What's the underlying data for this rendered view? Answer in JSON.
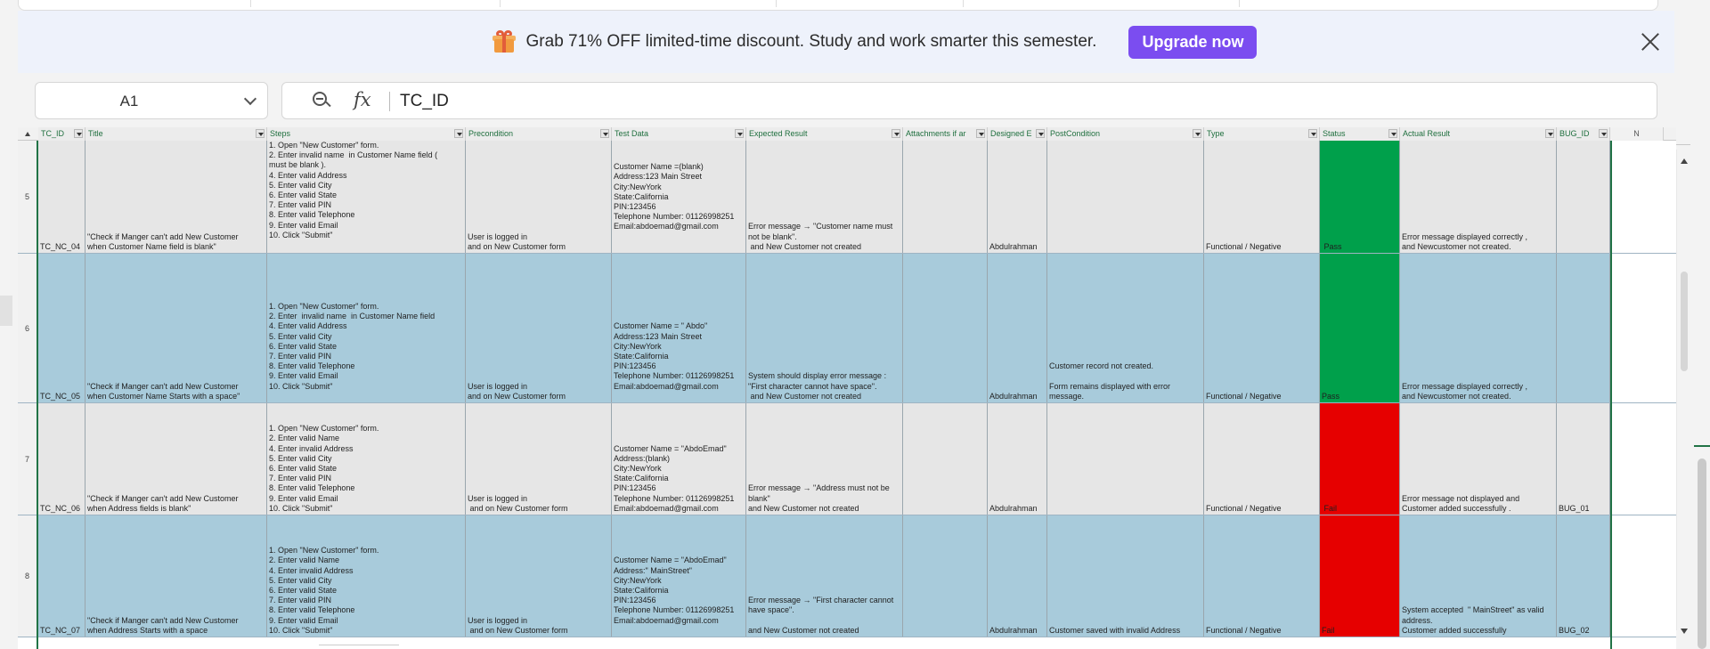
{
  "promo": {
    "text": "Grab 71% OFF limited-time discount. Study and work smarter this semester.",
    "button": "Upgrade now",
    "accent": "#7b4df0"
  },
  "formula_bar": {
    "cell_ref": "A1",
    "fx_label": "fx",
    "content": "TC_ID"
  },
  "columns": [
    {
      "label": "TC_ID",
      "filter": true
    },
    {
      "label": "Title",
      "filter": true
    },
    {
      "label": "Steps",
      "filter": true
    },
    {
      "label": "Precondition",
      "filter": true
    },
    {
      "label": "Test Data",
      "filter": true
    },
    {
      "label": "Expected Result",
      "filter": true
    },
    {
      "label": "Attachments if ar",
      "filter": true
    },
    {
      "label": "Designed E",
      "filter": true
    },
    {
      "label": "PostCondition",
      "filter": true
    },
    {
      "label": "Type",
      "filter": true
    },
    {
      "label": "Status",
      "filter": true
    },
    {
      "label": "Actual Result",
      "filter": true
    },
    {
      "label": "BUG_ID",
      "filter": true
    },
    {
      "label": "N",
      "filter": false
    }
  ],
  "rows": [
    {
      "num": "5",
      "theme": "gray",
      "status_color": "green",
      "cells": [
        "TC_NC_04",
        "\"Check if Manger can't add New Customer\nwhen Customer Name field is blank\"",
        "1. Open \"New Customer\" form.\n2. Enter invalid name  in Customer Name field (\nmust be blank ).\n4. Enter valid Address\n5. Enter valid City\n6. Enter valid State\n7. Enter valid PIN\n8. Enter valid Telephone\n9. Enter valid Email\n10. Click \"Submit\"\n\n\n",
        "User is logged in\nand on New Customer form\n",
        "Customer Name =(blank)\nAddress:123 Main Street\nCity:NewYork\nState:California\nPIN:123456\nTelephone Number: 01126998251\nEmail:abdoemad@gmail.com\n\n\n",
        "Error message → \"Customer name must\nnot be blank\".\n and New Customer not created",
        "",
        "Abdulrahman",
        "",
        "Functional / Negative",
        " Pass",
        "Error message displayed correctly ,\nand Newcustomer not created.",
        ""
      ]
    },
    {
      "num": "6",
      "theme": "blue",
      "status_color": "green",
      "cells": [
        "TC_NC_05",
        "\"Check if Manger can't add New Customer\nwhen Customer Name Starts with a space\"",
        "1. Open \"New Customer\" form.\n2. Enter  invalid name  in Customer Name field\n4. Enter valid Address\n5. Enter valid City\n6. Enter valid State\n7. Enter valid PIN\n8. Enter valid Telephone\n9. Enter valid Email\n10. Click \"Submit\"\n\n",
        "User is logged in\nand on New Customer form",
        "Customer Name = \" Abdo\"\nAddress:123 Main Street\nCity:NewYork\nState:California\nPIN:123456\nTelephone Number: 01126998251\nEmail:abdoemad@gmail.com\n\n",
        "System should display error message :\n\"First character cannot have space\".\n and New Customer not created",
        "",
        "Abdulrahman",
        "Customer record not created.\n\nForm remains displayed with error\nmessage.",
        "Functional / Negative",
        "Pass",
        "Error message displayed correctly ,\nand Newcustomer not created.",
        ""
      ]
    },
    {
      "num": "7",
      "theme": "gray",
      "status_color": "red",
      "cells": [
        "TC_NC_06",
        "\"Check if Manger can't add New Customer\nwhen Address fields is blank\"",
        "1. Open \"New Customer\" form.\n2. Enter valid Name\n4. Enter invalid Address\n5. Enter valid City\n6. Enter valid State\n7. Enter valid PIN\n8. Enter valid Telephone\n9. Enter valid Email\n10. Click \"Submit\"\n",
        "User is logged in\n and on New Customer form",
        "Customer Name = \"AbdoEmad\"\nAddress:(blank)\nCity:NewYork\nState:California\nPIN:123456\nTelephone Number: 01126998251\nEmail:abdoemad@gmail.com\n",
        "Error message → \"Address must not be\nblank\"\nand New Customer not created",
        "",
        "Abdulrahman",
        "",
        "Functional / Negative",
        " Fail",
        "Error message not displayed and\nCustomer added successfully .",
        "BUG_01"
      ]
    },
    {
      "num": "8",
      "theme": "blue",
      "status_color": "red",
      "cells": [
        "TC_NC_07",
        "\"Check if Manger can't add New Customer\nwhen Address Starts with a space",
        "1. Open \"New Customer\" form.\n2. Enter valid Name\n4. Enter invalid Address\n5. Enter valid City\n6. Enter valid State\n7. Enter valid PIN\n8. Enter valid Telephone\n9. Enter valid Email\n10. Click \"Submit\"",
        "User is logged in\n and on New Customer form",
        "Customer Name = \"AbdoEmad\"\nAddress:\" MainStreet\"\nCity:NewYork\nState:California\nPIN:123456\nTelephone Number: 01126998251\nEmail:abdoemad@gmail.com\n\n",
        "Error message → \"First character cannot\nhave space\".\n\nand New Customer not created",
        "",
        "Abdulrahman",
        "Customer saved with invalid Address",
        "Functional / Negative",
        "Fail",
        "System accepted  \" MainStreet\" as valid\naddress.\nCustomer added successfully",
        "BUG_02"
      ]
    }
  ]
}
